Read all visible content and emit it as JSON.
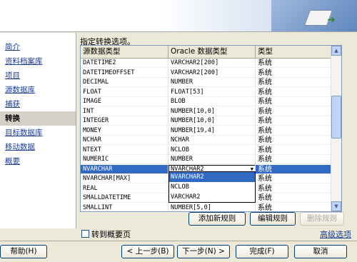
{
  "nav": {
    "items": [
      {
        "label": "简介",
        "active": false
      },
      {
        "label": "资料档案库",
        "active": false
      },
      {
        "label": "项目",
        "active": false
      },
      {
        "label": "源数据库",
        "active": false
      },
      {
        "label": "捕获",
        "active": false
      },
      {
        "label": "转换",
        "active": true
      },
      {
        "label": "目标数据库",
        "active": false
      },
      {
        "label": "移动数据",
        "active": false
      },
      {
        "label": "概要",
        "active": false
      }
    ]
  },
  "main": {
    "instruction": "指定转换选项。",
    "columns": [
      "源数据类型",
      "Oracle 数据类型",
      "类型"
    ],
    "rows": [
      [
        "DATETIME2",
        "VARCHAR2[200]",
        "系统"
      ],
      [
        "DATETIMEOFFSET",
        "VARCHAR2[200]",
        "系统"
      ],
      [
        "DECIMAL",
        "NUMBER",
        "系统"
      ],
      [
        "FLOAT",
        "FLOAT[53]",
        "系统"
      ],
      [
        "IMAGE",
        "BLOB",
        "系统"
      ],
      [
        "INT",
        "NUMBER[10,0]",
        "系统"
      ],
      [
        "INTEGER",
        "NUMBER[10,0]",
        "系统"
      ],
      [
        "MONEY",
        "NUMBER[19,4]",
        "系统"
      ],
      [
        "NCHAR",
        "NCHAR",
        "系统"
      ],
      [
        "NTEXT",
        "NCLOB",
        "系统"
      ],
      [
        "NUMERIC",
        "NUMBER",
        "系统"
      ],
      [
        "NVARCHAR",
        "NVARCHAR2",
        "系统"
      ],
      [
        "NVARCHAR[MAX]",
        "",
        "系统"
      ],
      [
        "REAL",
        "",
        "系统"
      ],
      [
        "SMALLDATETIME",
        "",
        "系统"
      ],
      [
        "SMALLINT",
        "NUMBER[5,0]",
        "系统"
      ]
    ],
    "selected_row": 11,
    "combo_value": "NVARCHAR2",
    "dropdown_options": [
      "NVARCHAR2",
      "NCLOB",
      "VARCHAR2"
    ],
    "dropdown_highlight": 0
  },
  "rule_buttons": {
    "add": "添加新规则",
    "edit": "编辑规则",
    "delete": "删除规则"
  },
  "goto_summary": "转到概要页",
  "advanced": "高级选项",
  "footer": {
    "help": "帮助(H)",
    "back": "< 上一步(B)",
    "next": "下一步(N) >",
    "finish": "完成(F)",
    "cancel": "取消"
  },
  "colors": {
    "selection": "#316ac5",
    "link": "#1a3c9a"
  }
}
